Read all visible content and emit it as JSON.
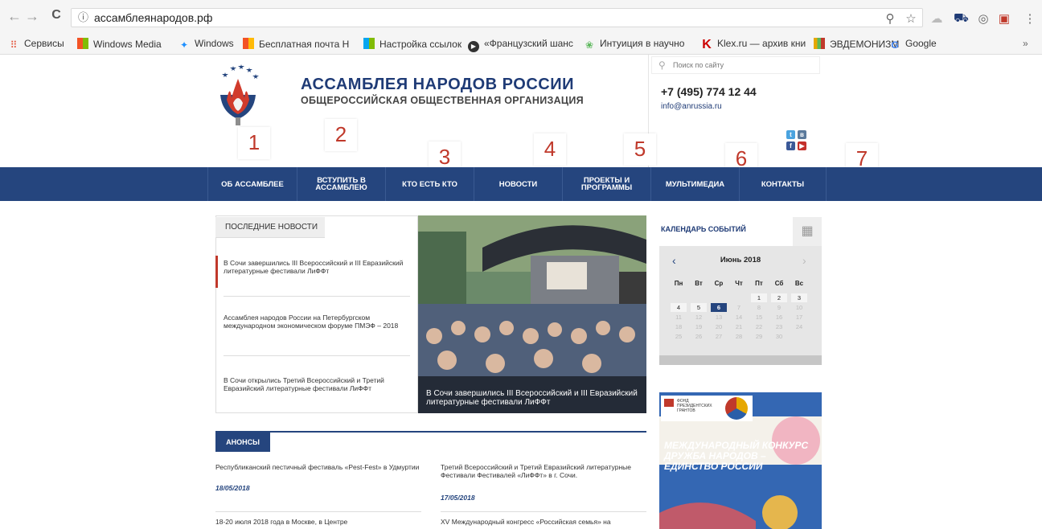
{
  "browser": {
    "url": "ассамблеянародов.рф",
    "back": "←",
    "forward": "→",
    "reload": "C",
    "info": "ⓘ",
    "toolbar_icons": [
      "zoom-icon",
      "star-icon",
      "extension-icon",
      "cart-icon",
      "extension2-icon",
      "pocket-icon",
      "menu-icon"
    ],
    "bookmarks": [
      {
        "label": "Сервисы",
        "icon": "apps-icon",
        "color": "#e34a2f"
      },
      {
        "label": "Windows Media",
        "icon": "windows-icon",
        "color": "#f35325"
      },
      {
        "label": "Windows",
        "icon": "winxp-icon",
        "color": "#1e90ff"
      },
      {
        "label": "Бесплатная почта Н",
        "icon": "windows-icon",
        "color": "#f35325"
      },
      {
        "label": "Настройка ссылок",
        "icon": "windows-icon",
        "color": "#05a6f0"
      },
      {
        "label": "«Французский шанс",
        "icon": "play-icon",
        "color": "#333333"
      },
      {
        "label": "Интуиция в научно",
        "icon": "leaf-icon",
        "color": "#5cb85c"
      },
      {
        "label": "Klex.ru — архив кни",
        "icon": "k-icon",
        "color": "#cc0000"
      },
      {
        "label": "ЭВДЕМОНИЗМ",
        "icon": "bars-icon",
        "color": "#e6a700"
      },
      {
        "label": "Google",
        "icon": "google-icon",
        "color": "#4285f4"
      }
    ],
    "more": "»"
  },
  "header": {
    "title": "АССАМБЛЕЯ НАРОДОВ РОССИИ",
    "subtitle": "ОБЩЕРОССИЙСКАЯ ОБЩЕСТВЕННАЯ ОРГАНИЗАЦИЯ",
    "search_placeholder": "Поиск по сайту",
    "phone": "+7 (495) 774 12 44",
    "email": "info@anrussia.ru"
  },
  "markers": [
    "1",
    "2",
    "3",
    "4",
    "5",
    "6",
    "7"
  ],
  "nav": [
    "ОБ АССАМБЛЕЕ",
    "ВСТУПИТЬ В АССАМБЛЕЮ",
    "КТО ЕСТЬ КТО",
    "НОВОСТИ",
    "ПРОЕКТЫ И ПРОГРАММЫ",
    "МУЛЬТИМЕДИА",
    "КОНТАКТЫ"
  ],
  "news": {
    "tab": "ПОСЛЕДНИЕ НОВОСТИ",
    "items": [
      "В Сочи завершились III Всероссийский и III Евразийский литературные фестивали ЛиФФт",
      "Ассамблея народов России на Петербургском международном экономическом форуме ПМЭФ – 2018",
      "В Сочи открылись Третий Всероссийский и Третий Евразийский литературные фестивали ЛиФФт"
    ],
    "photo_caption": "В Сочи завершились III Всероссийский и III Евразийский литературные фестивали ЛиФФт"
  },
  "calendar": {
    "title": "КАЛЕНДАРЬ СОБЫТИЙ",
    "month": "Июнь 2018",
    "prev": "‹",
    "next": "›",
    "weekdays": [
      "Пн",
      "Вт",
      "Ср",
      "Чт",
      "Пт",
      "Сб",
      "Вс"
    ],
    "days": [
      "1",
      "2",
      "3",
      "4",
      "5",
      "6",
      "7",
      "8",
      "9",
      "10",
      "11",
      "12",
      "13",
      "14",
      "15",
      "16",
      "17",
      "18",
      "19",
      "20",
      "21",
      "22",
      "23",
      "24",
      "25",
      "26",
      "27",
      "28",
      "29",
      "30"
    ],
    "selected": "6"
  },
  "anons": {
    "tab": "АНОНСЫ",
    "items": [
      {
        "title": "Республиканский пестичный фестиваль «Pest-Fest» в Удмуртии",
        "date": "18/05/2018"
      },
      {
        "title": "Третий Всероссийский и Третий Евразийский литературные Фестивали Фестивалей «ЛиФФт» в г. Сочи.",
        "date": "17/05/2018"
      },
      {
        "title": "18-20 июля 2018 года в Москве, в Центре",
        "date": ""
      },
      {
        "title": "XV Международный конгресс «Российская семья» на",
        "date": ""
      }
    ]
  },
  "banner": {
    "text": "МЕЖДУНАРОДНЫЙ КОНКУРС ДРУЖБА НАРОДОВ – ЕДИНСТВО РОССИИ",
    "fund": "ФОНД ПРЕЗИДЕНТСКИХ ГРАНТОВ"
  }
}
